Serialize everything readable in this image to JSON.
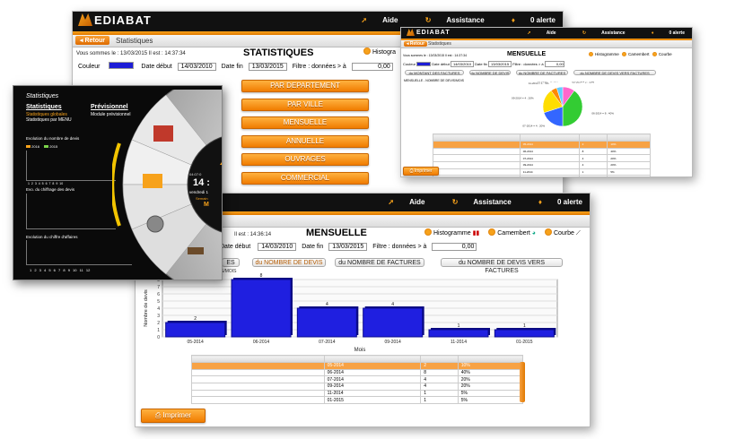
{
  "app": {
    "logo": "EDIABAT",
    "aide": "Aide",
    "assistance": "Assistance",
    "alertes": "0 alerte"
  },
  "back_window": {
    "retour": "Retour",
    "breadcrumb": "Statistiques",
    "title": "STATISTIQUES",
    "connected": "Vous sommes le : 13/03/2015  Il est : 14:37:34",
    "couleur_label": "Couleur",
    "date_debut_label": "Date début",
    "date_debut": "14/03/2010",
    "date_fin_label": "Date fin",
    "date_fin": "13/03/2015",
    "filtre_label": "Filtre : données > à",
    "filtre_value": "0,00",
    "histogramme_label": "Histogra",
    "menu": [
      "PAR DEPARTEMENT",
      "PAR VILLE",
      "MENSUELLE",
      "ANNUELLE",
      "OUVRAGES",
      "COMMERCIAL"
    ]
  },
  "small_window": {
    "retour": "Retour",
    "breadcrumb": "Statistiques",
    "title": "MENSUELLE",
    "connected": "Vous sommes le : 13/03/2015  Il est : 14:37:34",
    "couleur_label": "Couleur",
    "date_debut_label": "Date début",
    "date_debut": "14/03/2010",
    "date_fin_label": "Date fin",
    "date_fin": "13/03/2015",
    "filtre_label": "Filtre : données > à",
    "filtre_value": "0,00",
    "options": [
      "Histogramme",
      "Camembert",
      "Courbe"
    ],
    "tabs": [
      "du MONTANT DES FACTURES",
      "du NOMBRE DE DEVIS",
      "du NOMBRE DE FACTURES",
      "du NOMBRE DE DEVIS VERS FACTURES"
    ],
    "chart_title": "MENSUELLE - NOMBRE DE DEVIS/MOIS",
    "imprimer": "Imprimer"
  },
  "main_window": {
    "connected_time": "Il est : 14:36:14",
    "title": "MENSUELLE",
    "date_debut_label": "Date début",
    "date_debut": "14/03/2010",
    "date_fin_label": "Date fin",
    "date_fin": "13/03/2015",
    "filtre_label": "Filtre : données > à",
    "filtre_value": "0,00",
    "options": [
      "Histogramme",
      "Camembert",
      "Courbe"
    ],
    "tab_partial": "ES",
    "tabs": [
      "du NOMBRE DE DEVIS",
      "du NOMBRE DE FACTURES",
      "du NOMBRE DE DEVIS VERS FACTURES"
    ],
    "chart_subtitle": "S/MOIS",
    "imprimer": "Imprimer",
    "table": [
      [
        "05-2014",
        "2",
        "10%"
      ],
      [
        "06-2014",
        "8",
        "40%"
      ],
      [
        "07-2014",
        "4",
        "20%"
      ],
      [
        "09-2014",
        "4",
        "20%"
      ],
      [
        "11-2014",
        "1",
        "5%"
      ],
      [
        "01-2015",
        "1",
        "5%"
      ]
    ]
  },
  "dark_panel": {
    "title": "Statistiques",
    "stat_header": "Statistiques",
    "prev_header": "Prévisionnel",
    "stat_link1": "Statistiques globales",
    "stat_link2": "Statistiques par MENU",
    "prev_link1": "Module prévisionnel",
    "mini1_title": "Evolution du nombre de devis",
    "mini2_title": "Evo. du chiffrage des devis",
    "mini3_title": "Evolution du chiffre d'affaires",
    "legend1": "2016",
    "legend2": "2015",
    "dial_time": "14 :",
    "dial_small": "04:07:0",
    "dial_date": "vendredi 1",
    "dial_sub": "Semain",
    "dial_m": "M",
    "xticks": [
      "1",
      "2",
      "3",
      "4",
      "5",
      "6",
      "7",
      "8",
      "9",
      "10",
      "11",
      "12"
    ]
  },
  "chart_data": [
    {
      "type": "bar",
      "title": "",
      "xlabel": "Mois",
      "ylabel": "Nombre de devis",
      "categories": [
        "05-2014",
        "06-2014",
        "07-2014",
        "09-2014",
        "11-2014",
        "01-2015"
      ],
      "values": [
        2,
        8,
        4,
        4,
        1,
        1
      ],
      "ylim": [
        0,
        8
      ],
      "yticks": [
        "0",
        "1",
        "2",
        "3",
        "4",
        "5",
        "6",
        "7",
        "8"
      ],
      "color": "#1f1fe0",
      "grid": true
    },
    {
      "type": "pie",
      "categories": [
        "05-2014",
        "06-2014",
        "07-2014",
        "09-2014",
        "11-2014",
        "01-2015"
      ],
      "values": [
        2,
        8,
        4,
        4,
        1,
        1
      ],
      "colors": [
        "#ff66cc",
        "#33cc33",
        "#3366ff",
        "#ffdd00",
        "#ff8800",
        "#66ccff"
      ],
      "labels": [
        "05-2014 = 2 : 10%",
        "06-2014 = 8 : 40%",
        "07-2014 = 4 : 20%",
        "09-2014 = 4 : 20%",
        "11-2014 = 1 : 5%",
        "01-2015 = 1 : 5%"
      ]
    }
  ]
}
